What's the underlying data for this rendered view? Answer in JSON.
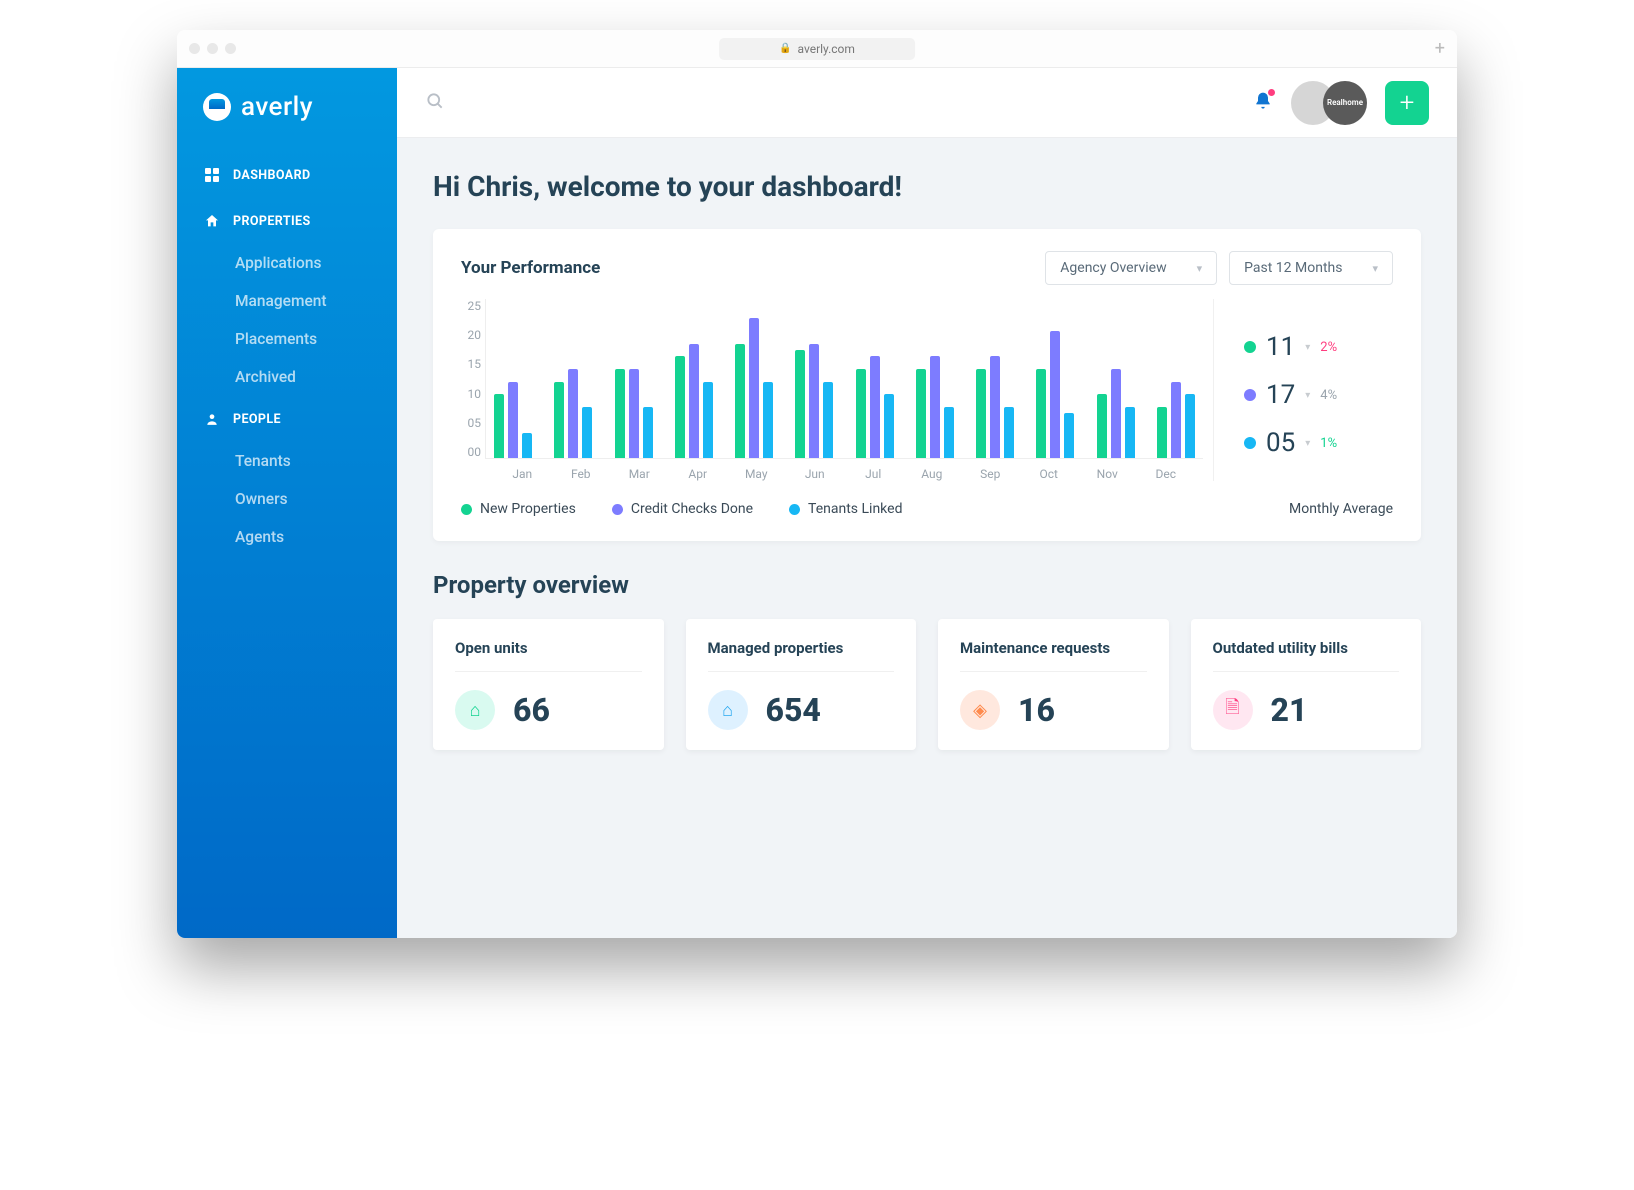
{
  "browser": {
    "url": "averly.com"
  },
  "brand": {
    "name": "averly"
  },
  "sidebar": {
    "dashboard": "DASHBOARD",
    "properties": "PROPERTIES",
    "properties_items": [
      "Applications",
      "Management",
      "Placements",
      "Archived"
    ],
    "people": "PEOPLE",
    "people_items": [
      "Tenants",
      "Owners",
      "Agents"
    ]
  },
  "header": {
    "brand_badge": "Realhome"
  },
  "welcome": "Hi Chris, welcome to your dashboard!",
  "performance": {
    "title": "Your Performance",
    "select1": "Agency Overview",
    "select2": "Past 12 Months",
    "side_label": "Monthly Average",
    "kpis": [
      {
        "value": "11",
        "change": "2%",
        "color": "#13d391",
        "changeColor": "#ff3d7f"
      },
      {
        "value": "17",
        "change": "4%",
        "color": "#7d7cff",
        "changeColor": "#9aa4ad"
      },
      {
        "value": "05",
        "change": "1%",
        "color": "#17b7f4",
        "changeColor": "#13d391"
      }
    ],
    "legend": [
      {
        "label": "New Properties",
        "color": "#13d391"
      },
      {
        "label": "Credit Checks Done",
        "color": "#7d7cff"
      },
      {
        "label": "Tenants Linked",
        "color": "#17b7f4"
      }
    ]
  },
  "chart_data": {
    "type": "bar",
    "title": "Your Performance",
    "xlabel": "",
    "ylabel": "",
    "ylim": [
      0,
      25
    ],
    "y_ticks": [
      25,
      20,
      15,
      10,
      5,
      0
    ],
    "y_tick_labels": [
      "25",
      "20",
      "15",
      "10",
      "05",
      "00"
    ],
    "categories": [
      "Jan",
      "Feb",
      "Mar",
      "Apr",
      "May",
      "Jun",
      "Jul",
      "Aug",
      "Sep",
      "Oct",
      "Nov",
      "Dec"
    ],
    "series": [
      {
        "name": "New Properties",
        "color": "#13d391",
        "values": [
          10,
          12,
          14,
          16,
          18,
          17,
          14,
          14,
          14,
          14,
          10,
          8
        ]
      },
      {
        "name": "Credit Checks Done",
        "color": "#7d7cff",
        "values": [
          12,
          14,
          14,
          18,
          22,
          18,
          16,
          16,
          16,
          20,
          14,
          12
        ]
      },
      {
        "name": "Tenants Linked",
        "color": "#17b7f4",
        "values": [
          4,
          8,
          8,
          12,
          12,
          12,
          10,
          8,
          8,
          7,
          8,
          10
        ]
      }
    ]
  },
  "overview": {
    "title": "Property overview",
    "cards": [
      {
        "label": "Open units",
        "value": "66",
        "iconClass": "ic-teal",
        "glyph": "⌂"
      },
      {
        "label": "Managed properties",
        "value": "654",
        "iconClass": "ic-blue",
        "glyph": "⌂"
      },
      {
        "label": "Maintenance requests",
        "value": "16",
        "iconClass": "ic-orange",
        "glyph": "◈"
      },
      {
        "label": "Outdated utility bills",
        "value": "21",
        "iconClass": "ic-pink",
        "glyph": "🗎"
      }
    ]
  }
}
